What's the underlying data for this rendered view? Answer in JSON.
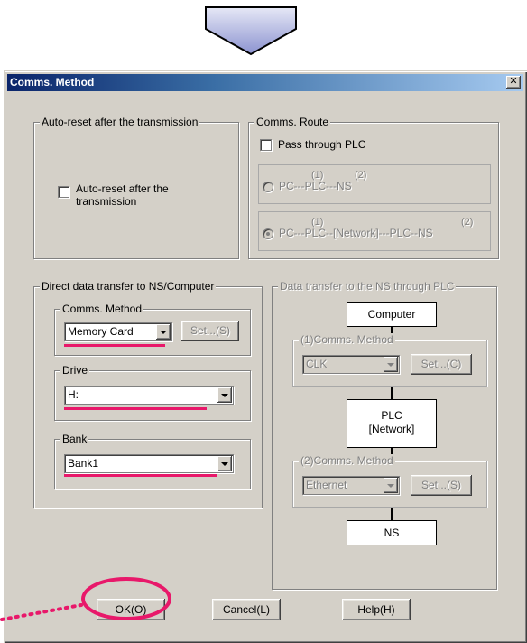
{
  "dialog": {
    "title": "Comms. Method",
    "close_glyph": "✕"
  },
  "auto_reset": {
    "group_label": "Auto-reset after the transmission",
    "checkbox_label_line1": "Auto-reset after the",
    "checkbox_label_line2": "transmission",
    "checked": false
  },
  "route": {
    "group_label": "Comms. Route",
    "pass_through_label": "Pass through PLC",
    "option1": {
      "num_a": "(1)",
      "num_b": "(2)",
      "path": "PC---PLC---NS"
    },
    "option2": {
      "num_a": "(1)",
      "num_b": "(2)",
      "path": "PC---PLC--[Network]---PLC--NS"
    }
  },
  "direct": {
    "group_label": "Direct data transfer to NS/Computer",
    "comms_method_label": "Comms. Method",
    "comms_method_value": "Memory Card",
    "set_button": "Set...(S)",
    "drive_label": "Drive",
    "drive_value": "H:",
    "bank_label": "Bank",
    "bank_value": "Bank1"
  },
  "through_plc": {
    "group_label": "Data transfer to the NS through PLC",
    "computer_box": "Computer",
    "method1_label": "(1)Comms. Method",
    "method1_value": "CLK",
    "set1_button": "Set...(C)",
    "plc_box_line1": "PLC",
    "plc_box_line2": "[Network]",
    "method2_label": "(2)Comms. Method",
    "method2_value": "Ethernet",
    "set2_button": "Set...(S)",
    "ns_box": "NS"
  },
  "buttons": {
    "ok": "OK(O)",
    "cancel": "Cancel(L)",
    "help": "Help(H)"
  },
  "colors": {
    "highlight": "#e8186a",
    "arrow_fill": "#9aa0d8",
    "dialog_face": "#d4d0c8"
  }
}
